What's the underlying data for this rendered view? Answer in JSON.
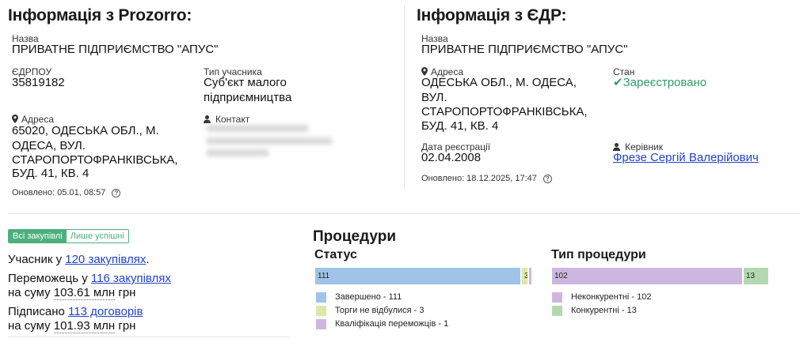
{
  "prozorro": {
    "title": "Інформація з Prozorro:",
    "name_label": "Назва",
    "name_value": "ПРИВАТНЕ ПІДПРИЄМСТВО \"АПУС\"",
    "edrpou_label": "ЄДРПОУ",
    "edrpou_value": "35819182",
    "type_label": "Тип учасника",
    "type_value_line1": "Суб'єкт малого",
    "type_value_line2": "підприємництва",
    "address_label": "Адреса",
    "address_line1": "65020, ОДЕСЬКА ОБЛ., М.",
    "address_line2": "ОДЕСА, ВУЛ.",
    "address_line3": "СТАРОПОРТОФРАНКІВСЬКА,",
    "address_line4": "БУД. 41, КВ. 4",
    "contact_label": "Контакт",
    "updated": "Оновлено: 05.01, 08:57",
    "help_glyph": "?"
  },
  "edr": {
    "title": "Інформація з ЄДР:",
    "name_label": "Назва",
    "name_value": "ПРИВАТНЕ ПІДПРИЄМСТВО \"АПУС\"",
    "address_label": "Адреса",
    "address_line1": "ОДЕСЬКА ОБЛ., М. ОДЕСА,",
    "address_line2": "ВУЛ.",
    "address_line3": "СТАРОПОРТОФРАНКІВСЬКА,",
    "address_line4": "БУД. 41, КВ. 4",
    "state_label": "Стан",
    "state_value": "Зареєстровано",
    "state_check": "✔",
    "reg_date_label": "Дата реєстрації",
    "reg_date_value": "02.04.2008",
    "head_label": "Керівник",
    "head_value": "Фрезе Сергій Валерійович",
    "updated": "Оновлено: 18.12.2025, 17:47",
    "help_glyph": "?"
  },
  "filters": {
    "all": "Всі закупівлі",
    "successful": "Лише успішні"
  },
  "stats": {
    "participant_prefix": "Учасник у ",
    "participant_link": "120 закупівлях",
    "participant_suffix": ".",
    "winner_prefix": "Переможець у ",
    "winner_link": "116 закупівлях",
    "winner_sum_prefix": "на суму ",
    "winner_sum": "103.61 млн",
    "winner_currency": " грн",
    "signed_prefix": "Підписано ",
    "signed_link": "113 договорів",
    "signed_sum_prefix": "на суму ",
    "signed_sum": "101.93 млн",
    "signed_currency": " грн"
  },
  "procedures": {
    "title": "Процедури",
    "status": {
      "title": "Статус",
      "segments": [
        {
          "label": "111",
          "value": 111,
          "color": "#9fc4e8"
        },
        {
          "label": "3",
          "value": 3,
          "color": "#dde8a8"
        },
        {
          "label": "",
          "value": 1,
          "color": "#cdb7e0"
        }
      ],
      "legend": [
        {
          "text": "Завершено - 111",
          "color": "#9fc4e8"
        },
        {
          "text": "Торги не відбулися - 3",
          "color": "#dde8a8"
        },
        {
          "text": "Кваліфікація переможців - 1",
          "color": "#cdb7e0"
        }
      ]
    },
    "type": {
      "title": "Тип процедури",
      "segments": [
        {
          "label": "102",
          "value": 102,
          "color": "#cdb7e0"
        },
        {
          "label": "13",
          "value": 13,
          "color": "#b4d9b0"
        }
      ],
      "legend": [
        {
          "text": "Неконкурентні - 102",
          "color": "#cdb7e0"
        },
        {
          "text": "Конкурентні - 13",
          "color": "#b4d9b0"
        }
      ]
    }
  }
}
